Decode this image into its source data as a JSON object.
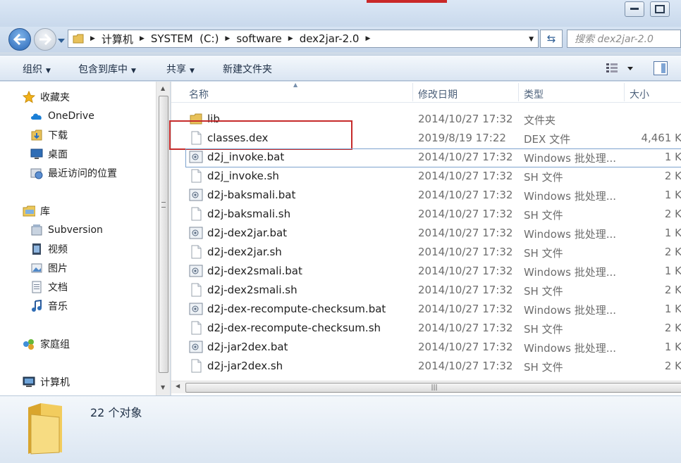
{
  "breadcrumb": [
    "计算机",
    "SYSTEM  (C:)",
    "software",
    "dex2jar-2.0"
  ],
  "search": {
    "placeholder": "搜索 dex2jar-2.0"
  },
  "toolbar": {
    "organize": "组织",
    "include_library": "包含到库中",
    "share": "共享",
    "new_folder": "新建文件夹"
  },
  "nav": {
    "favorites": "收藏夹",
    "onedrive": "OneDrive",
    "downloads": "下载",
    "desktop": "桌面",
    "recent": "最近访问的位置",
    "libraries": "库",
    "subversion": "Subversion",
    "videos": "视频",
    "pictures": "图片",
    "documents": "文档",
    "music": "音乐",
    "homegroup": "家庭组",
    "computer": "计算机"
  },
  "columns": {
    "name": "名称",
    "date": "修改日期",
    "type": "类型",
    "size": "大小"
  },
  "files": [
    {
      "name": "lib",
      "date": "2014/10/27 17:32",
      "type": "文件夹",
      "size": "",
      "icon": "folder-icon"
    },
    {
      "name": "classes.dex",
      "date": "2019/8/19 17:22",
      "type": "DEX 文件",
      "size": "4,461 K",
      "icon": "file-icon"
    },
    {
      "name": "d2j_invoke.bat",
      "date": "2014/10/27 17:32",
      "type": "Windows 批处理...",
      "size": "1 K",
      "icon": "bat-icon"
    },
    {
      "name": "d2j_invoke.sh",
      "date": "2014/10/27 17:32",
      "type": "SH 文件",
      "size": "2 K",
      "icon": "file-icon"
    },
    {
      "name": "d2j-baksmali.bat",
      "date": "2014/10/27 17:32",
      "type": "Windows 批处理...",
      "size": "1 K",
      "icon": "bat-icon"
    },
    {
      "name": "d2j-baksmali.sh",
      "date": "2014/10/27 17:32",
      "type": "SH 文件",
      "size": "2 K",
      "icon": "file-icon"
    },
    {
      "name": "d2j-dex2jar.bat",
      "date": "2014/10/27 17:32",
      "type": "Windows 批处理...",
      "size": "1 K",
      "icon": "bat-icon"
    },
    {
      "name": "d2j-dex2jar.sh",
      "date": "2014/10/27 17:32",
      "type": "SH 文件",
      "size": "2 K",
      "icon": "file-icon"
    },
    {
      "name": "d2j-dex2smali.bat",
      "date": "2014/10/27 17:32",
      "type": "Windows 批处理...",
      "size": "1 K",
      "icon": "bat-icon"
    },
    {
      "name": "d2j-dex2smali.sh",
      "date": "2014/10/27 17:32",
      "type": "SH 文件",
      "size": "2 K",
      "icon": "file-icon"
    },
    {
      "name": "d2j-dex-recompute-checksum.bat",
      "date": "2014/10/27 17:32",
      "type": "Windows 批处理...",
      "size": "1 K",
      "icon": "bat-icon"
    },
    {
      "name": "d2j-dex-recompute-checksum.sh",
      "date": "2014/10/27 17:32",
      "type": "SH 文件",
      "size": "2 K",
      "icon": "file-icon"
    },
    {
      "name": "d2j-jar2dex.bat",
      "date": "2014/10/27 17:32",
      "type": "Windows 批处理...",
      "size": "1 K",
      "icon": "bat-icon"
    },
    {
      "name": "d2j-jar2dex.sh",
      "date": "2014/10/27 17:32",
      "type": "SH 文件",
      "size": "2 K",
      "icon": "file-icon"
    }
  ],
  "status": {
    "item_count": "22 个对象"
  }
}
